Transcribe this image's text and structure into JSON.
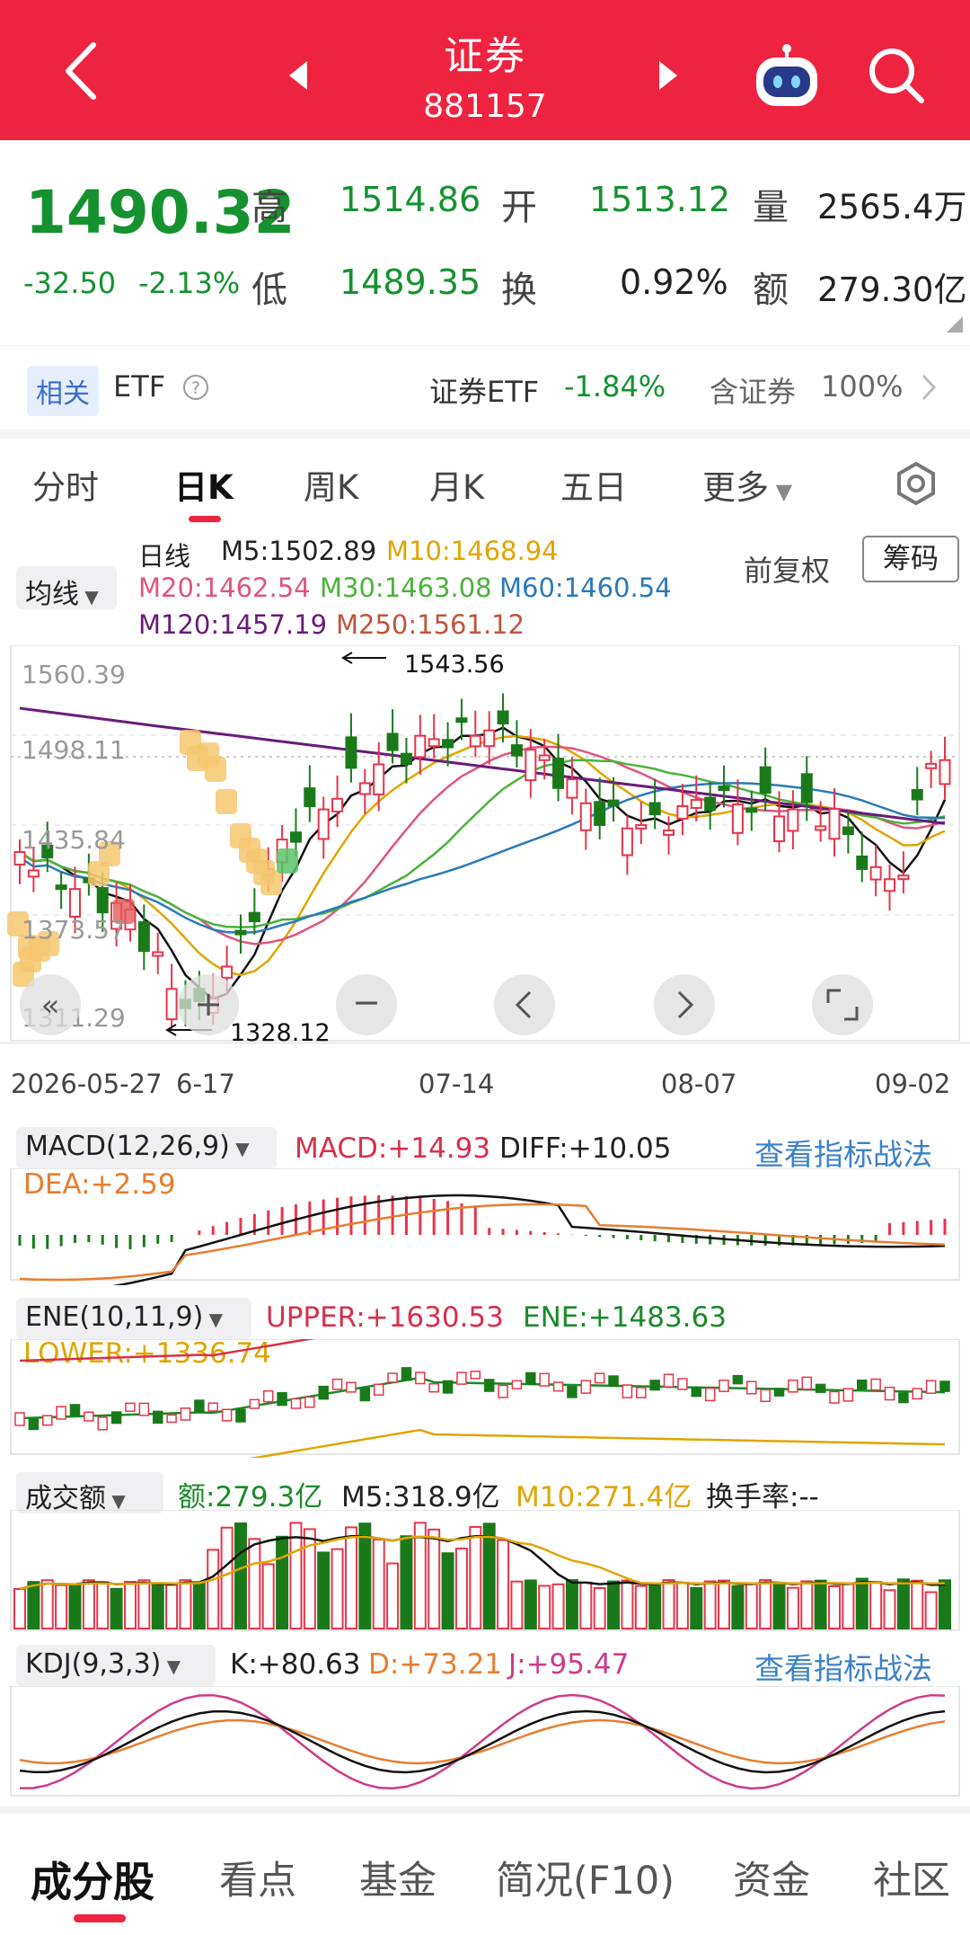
{
  "header": {
    "title": "证券",
    "code": "881157"
  },
  "quote": {
    "price": "1490.32",
    "change": "-32.50",
    "change_pct": "-2.13%",
    "high_label": "高",
    "high": "1514.86",
    "open_label": "开",
    "open": "1513.12",
    "vol_label": "量",
    "vol": "2565.4万",
    "low_label": "低",
    "low": "1489.35",
    "turn_label": "换",
    "turn": "0.92%",
    "amt_label": "额",
    "amt": "279.30亿"
  },
  "related": {
    "badge": "相关",
    "etf": "ETF",
    "etf_name": "证券ETF",
    "etf_pct": "-1.84%",
    "contain_label": "含证券",
    "contain_value": "100%"
  },
  "tabs": [
    "分时",
    "日K",
    "周K",
    "月K",
    "五日",
    "更多"
  ],
  "ma_legend": {
    "selector": "均线",
    "title": "日线",
    "m5": "M5:1502.89",
    "m10": "M10:1468.94",
    "m20": "M20:1462.54",
    "m30": "M30:1463.08",
    "m60": "M60:1460.54",
    "m120": "M120:1457.19",
    "m250": "M250:1561.12",
    "fq": "前复权",
    "chips": "筹码"
  },
  "kline": {
    "ylabels": [
      "1560.39",
      "1498.11",
      "1435.84",
      "1373.57",
      "1311.29"
    ],
    "max_label": "1543.56",
    "min_label": "1328.12",
    "dates": [
      "2026-05-27",
      "6-17",
      "07-14",
      "08-07",
      "09-02"
    ]
  },
  "macd": {
    "selector": "MACD(12,26,9)",
    "macd": "MACD:+14.93",
    "diff": "DIFF:+10.05",
    "dea": "DEA:+2.59",
    "strategy": "查看指标战法"
  },
  "ene": {
    "selector": "ENE(10,11,9)",
    "upper": "UPPER:+1630.53",
    "ene": "ENE:+1483.63",
    "lower": "LOWER:+1336.74"
  },
  "amount": {
    "selector": "成交额",
    "amt": "额:279.3亿",
    "m5": "M5:318.9亿",
    "m10": "M10:271.4亿",
    "turnover": "换手率:--"
  },
  "kdj": {
    "selector": "KDJ(9,3,3)",
    "k": "K:+80.63",
    "d": "D:+73.21",
    "j": "J:+95.47",
    "strategy": "查看指标战法"
  },
  "bottom_tabs": [
    "成分股",
    "看点",
    "基金",
    "简况(F10)",
    "资金",
    "社区"
  ],
  "colors": {
    "red": "#ee2340",
    "green": "#15922f",
    "up": "#e8344a",
    "down": "#1a7a1a"
  }
}
